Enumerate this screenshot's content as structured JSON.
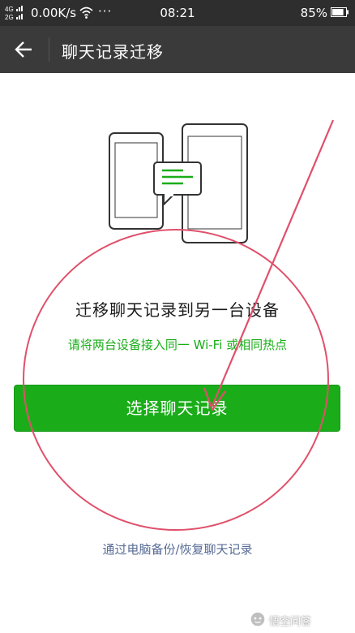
{
  "status_bar": {
    "network_type_top": "4G",
    "network_type_bottom": "2G",
    "speed": "0.00K/s",
    "more": "···",
    "time": "08:21",
    "battery_percent": "85%",
    "battery_level": 0.85
  },
  "title_bar": {
    "title": "聊天记录迁移",
    "back_icon": "arrow-left-icon"
  },
  "main": {
    "illustration_icon": "devices-chat-illustration-icon",
    "headline": "迁移聊天记录到另一台设备",
    "hint": "请将两台设备接入同一 Wi-Fi 或相同热点",
    "select_button_label": "选择聊天记录",
    "pc_backup_link": "通过电脑备份/恢复聊天记录"
  },
  "watermark": {
    "text": "悟空问答"
  },
  "colors": {
    "status_bar_bg": "#2e2e2e",
    "title_bar_bg": "#3a3a3a",
    "primary_green": "#1aad19",
    "link_blue": "#576b95",
    "annotation_red": "#e0506b"
  }
}
